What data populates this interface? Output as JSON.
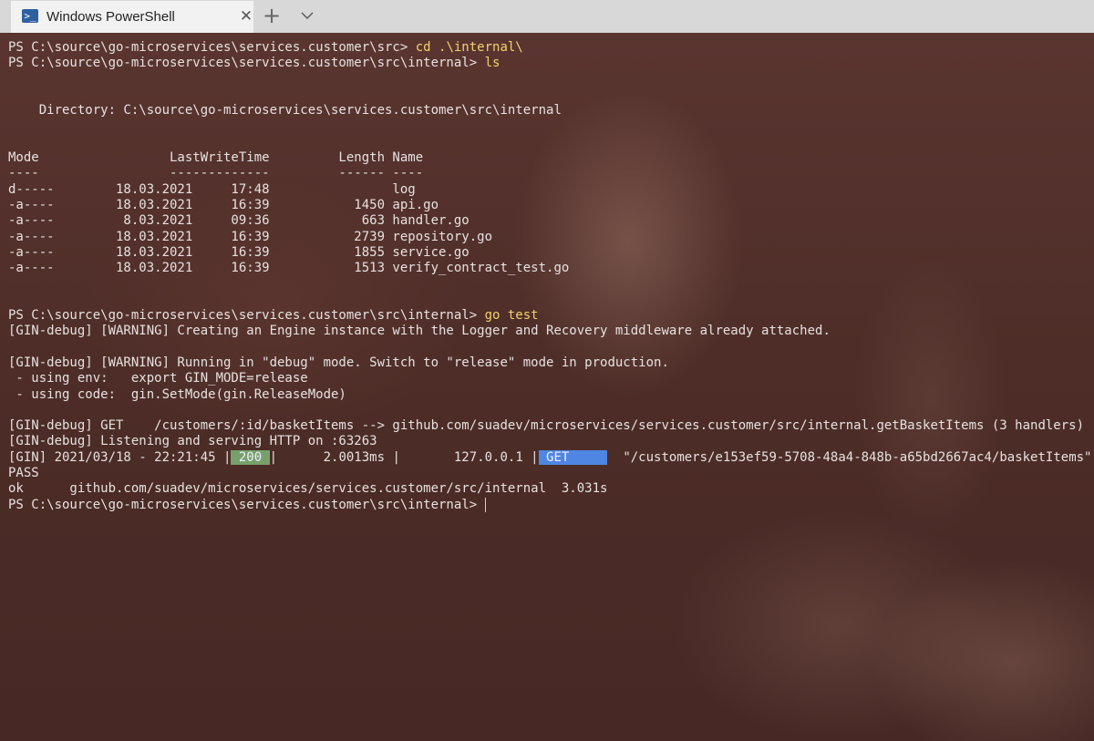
{
  "tab": {
    "title": "Windows PowerShell",
    "icon": "powershell-icon",
    "close_glyph": "✕",
    "new_tab_glyph": "+"
  },
  "terminal": {
    "prompt_cd": "PS C:\\source\\go-microservices\\services.customer\\src> ",
    "cmd_cd": "cd .\\internal\\",
    "prompt_ls": "PS C:\\source\\go-microservices\\services.customer\\src\\internal> ",
    "cmd_ls": "ls",
    "directory_line": "    Directory: C:\\source\\go-microservices\\services.customer\\src\\internal",
    "header_line": "Mode                 LastWriteTime         Length Name",
    "underline_line": "----                 -------------         ------ ----",
    "rows": [
      "d-----        18.03.2021     17:48                log",
      "-a----        18.03.2021     16:39           1450 api.go",
      "-a----         8.03.2021     09:36            663 handler.go",
      "-a----        18.03.2021     16:39           2739 repository.go",
      "-a----        18.03.2021     16:39           1855 service.go",
      "-a----        18.03.2021     16:39           1513 verify_contract_test.go"
    ],
    "prompt_test": "PS C:\\source\\go-microservices\\services.customer\\src\\internal> ",
    "cmd_test": "go test",
    "gin_warning_1": "[GIN-debug] [WARNING] Creating an Engine instance with the Logger and Recovery middleware already attached.",
    "gin_warning_2": "[GIN-debug] [WARNING] Running in \"debug\" mode. Switch to \"release\" mode in production.",
    "gin_env": " - using env:   export GIN_MODE=release",
    "gin_code": " - using code:  gin.SetMode(gin.ReleaseMode)",
    "gin_route": "[GIN-debug] GET    /customers/:id/basketItems --> github.com/suadev/microservices/services.customer/src/internal.getBasketItems (3 handlers)",
    "gin_listen": "[GIN-debug] Listening and serving HTTP on :63263",
    "log_prefix": "[GIN] 2021/03/18 - 22:21:45 |",
    "log_status": " 200 ",
    "log_middle": "|      2.0013ms |       127.0.0.1 |",
    "log_method": " GET     ",
    "log_path": "  \"/customers/e153ef59-5708-48a4-848b-a65bd2667ac4/basketItems\"",
    "pass": "PASS",
    "ok_line": "ok      github.com/suadev/microservices/services.customer/src/internal  3.031s",
    "prompt_final": "PS C:\\source\\go-microservices\\services.customer\\src\\internal> "
  }
}
